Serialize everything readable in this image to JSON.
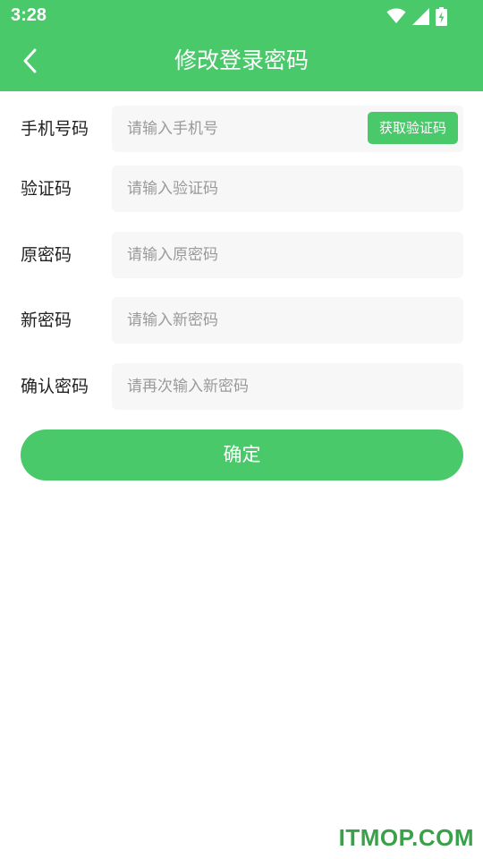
{
  "status_bar": {
    "time": "3:28",
    "icons": [
      "wifi-icon",
      "cellular-signal-icon",
      "battery-charging-icon"
    ]
  },
  "toolbar": {
    "title": "修改登录密码",
    "back_icon": "chevron-left-icon"
  },
  "form": {
    "phone": {
      "label": "手机号码",
      "placeholder": "请输入手机号",
      "value": "",
      "get_code_label": "获取验证码"
    },
    "code": {
      "label": "验证码",
      "placeholder": "请输入验证码",
      "value": ""
    },
    "old_password": {
      "label": "原密码",
      "placeholder": "请输入原密码",
      "value": ""
    },
    "new_password": {
      "label": "新密码",
      "placeholder": "请输入新密码",
      "value": ""
    },
    "confirm_password": {
      "label": "确认密码",
      "placeholder": "请再次输入新密码",
      "value": ""
    },
    "submit_label": "确定"
  },
  "watermark": "ITMOP.COM",
  "colors": {
    "accent": "#4ac96b",
    "input_background": "#f7f7f7",
    "label_text": "#222222",
    "placeholder_text": "#9a9a9a",
    "watermark": "#3aa14a"
  }
}
